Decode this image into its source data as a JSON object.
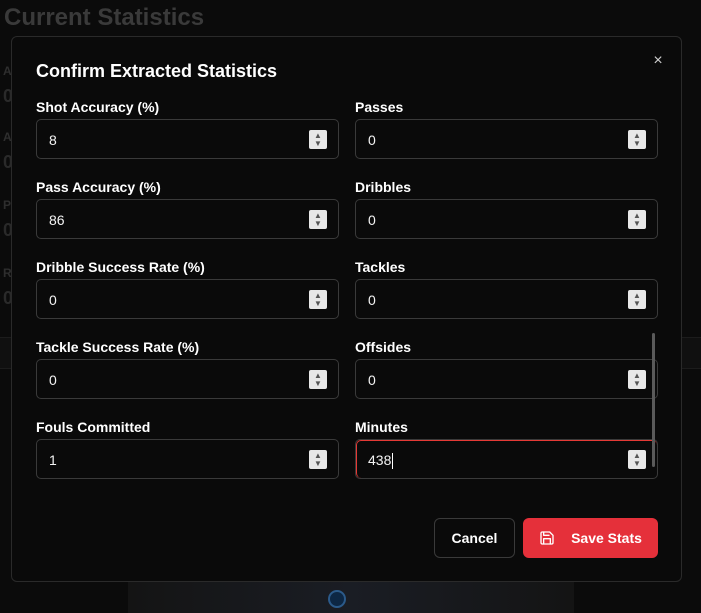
{
  "background": {
    "title": "Current Statistics",
    "letters": [
      "A",
      "A",
      "P",
      "R"
    ],
    "big_values": [
      "0",
      "0",
      "0",
      "0"
    ]
  },
  "modal": {
    "title": "Confirm Extracted Statistics",
    "close_glyph": "×",
    "fields": [
      {
        "label": "Shot Accuracy (%)",
        "value": "8"
      },
      {
        "label": "Passes",
        "value": "0"
      },
      {
        "label": "Pass Accuracy (%)",
        "value": "86"
      },
      {
        "label": "Dribbles",
        "value": "0"
      },
      {
        "label": "Dribble Success Rate (%)",
        "value": "0"
      },
      {
        "label": "Tackles",
        "value": "0"
      },
      {
        "label": "Tackle Success Rate (%)",
        "value": "0"
      },
      {
        "label": "Offsides",
        "value": "0"
      },
      {
        "label": "Fouls Committed",
        "value": "1"
      },
      {
        "label": "Minutes",
        "value": "438"
      }
    ],
    "cancel_label": "Cancel",
    "save_label": "Save Stats"
  },
  "colors": {
    "accent": "#e5303a",
    "focus_border": "#e53935",
    "background": "#0b0b0b"
  },
  "icons": {
    "close": "close-icon",
    "save": "save-icon",
    "spinner_up": "chevron-up-icon",
    "spinner_down": "chevron-down-icon"
  }
}
